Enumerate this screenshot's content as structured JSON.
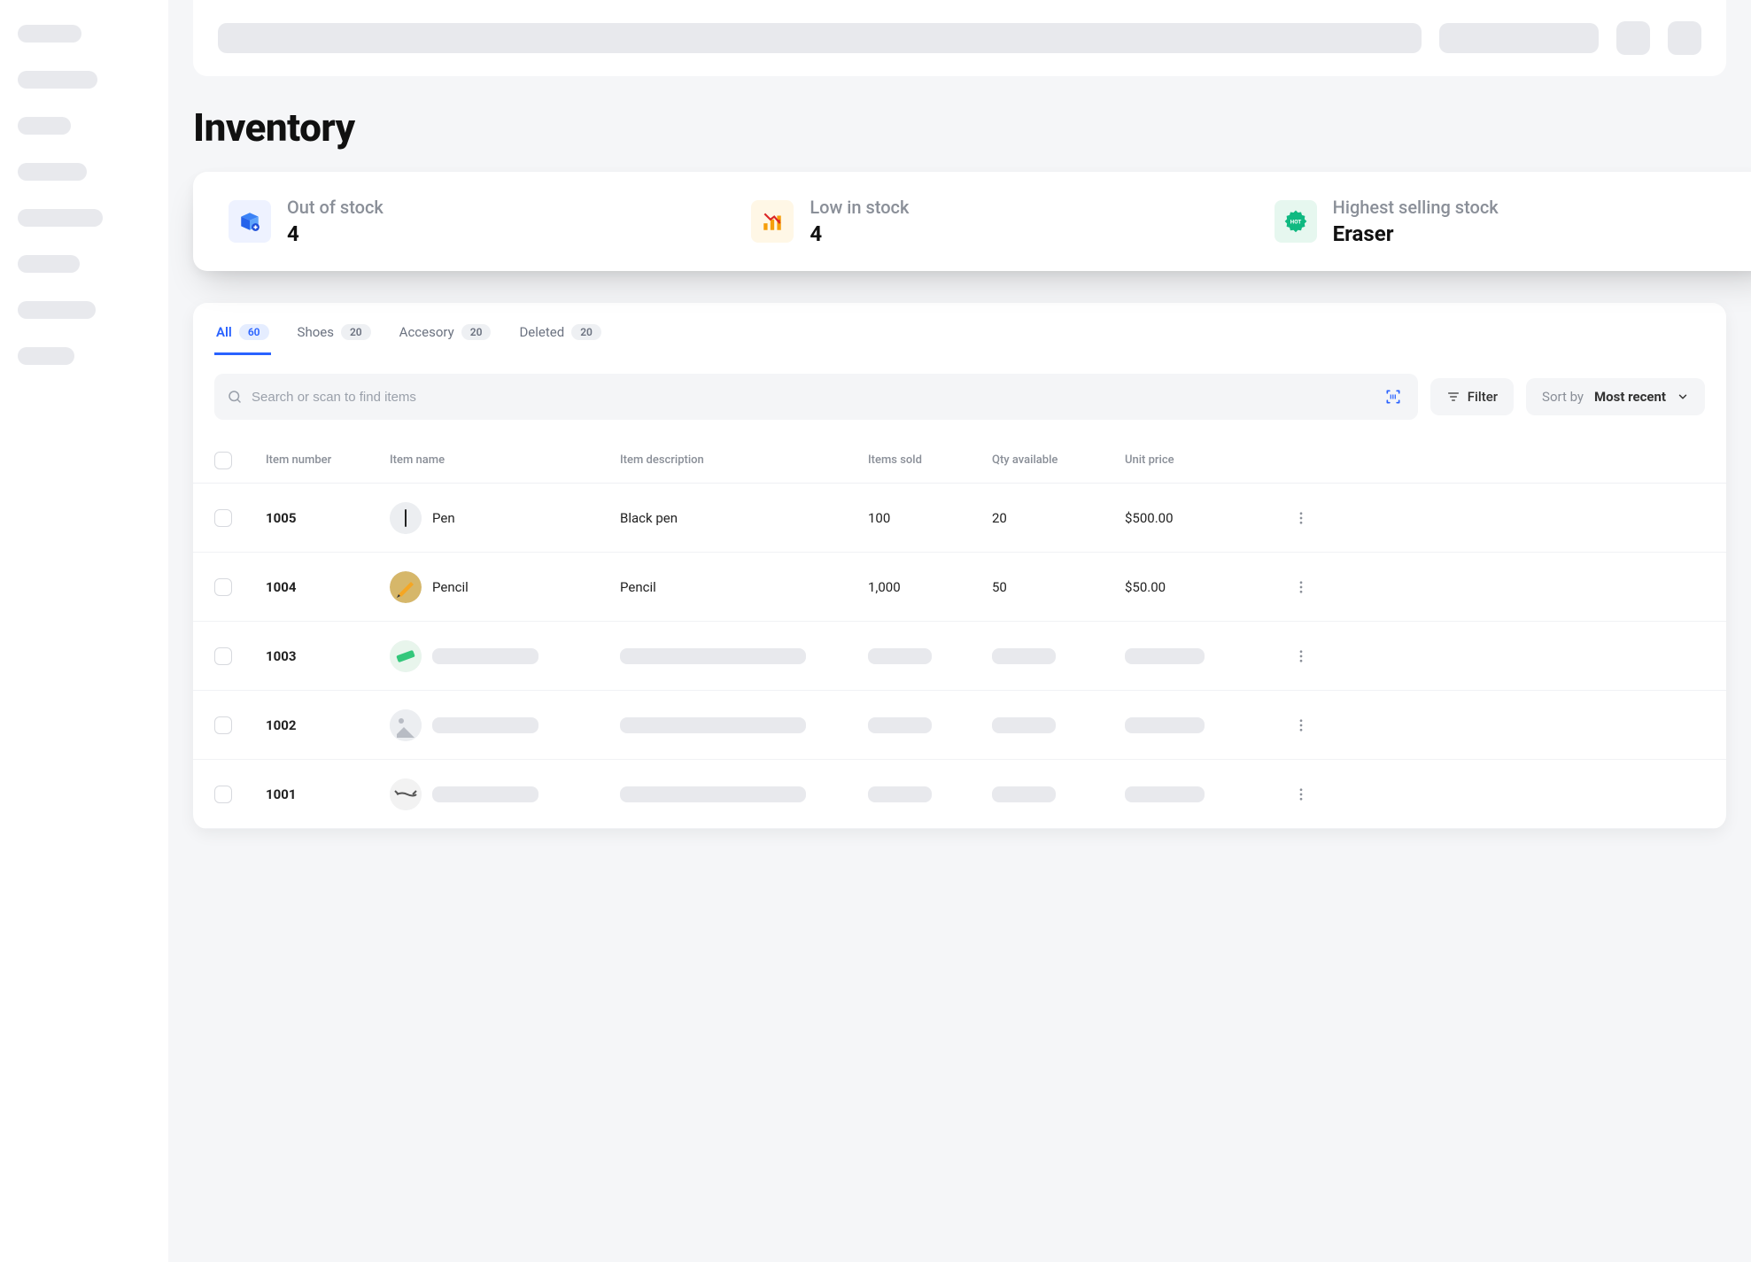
{
  "page": {
    "title": "Inventory"
  },
  "stats": [
    {
      "icon": "box-out-icon",
      "label": "Out of stock",
      "value": "4"
    },
    {
      "icon": "chart-down-icon",
      "label": "Low in stock",
      "value": "4"
    },
    {
      "icon": "hot-badge-icon",
      "label": "Highest selling stock",
      "value": "Eraser"
    }
  ],
  "tabs": [
    {
      "label": "All",
      "count": "60",
      "active": true
    },
    {
      "label": "Shoes",
      "count": "20",
      "active": false
    },
    {
      "label": "Accesory",
      "count": "20",
      "active": false
    },
    {
      "label": "Deleted",
      "count": "20",
      "active": false
    }
  ],
  "search": {
    "placeholder": "Search or scan to find items"
  },
  "filter": {
    "label": "Filter"
  },
  "sort": {
    "label": "Sort by",
    "value": "Most recent"
  },
  "columns": {
    "item_number": "Item number",
    "item_name": "Item name",
    "item_description": "Item description",
    "items_sold": "Items sold",
    "qty_available": "Qty available",
    "unit_price": "Unit price"
  },
  "rows": [
    {
      "number": "1005",
      "name": "Pen",
      "desc": "Black pen",
      "sold": "100",
      "qty": "20",
      "price": "$500.00",
      "placeholder": false
    },
    {
      "number": "1004",
      "name": "Pencil",
      "desc": "Pencil",
      "sold": "1,000",
      "qty": "50",
      "price": "$50.00",
      "placeholder": false
    },
    {
      "number": "1003",
      "name": "",
      "desc": "",
      "sold": "",
      "qty": "",
      "price": "",
      "placeholder": true
    },
    {
      "number": "1002",
      "name": "",
      "desc": "",
      "sold": "",
      "qty": "",
      "price": "",
      "placeholder": true
    },
    {
      "number": "1001",
      "name": "",
      "desc": "",
      "sold": "",
      "qty": "",
      "price": "",
      "placeholder": true
    }
  ]
}
